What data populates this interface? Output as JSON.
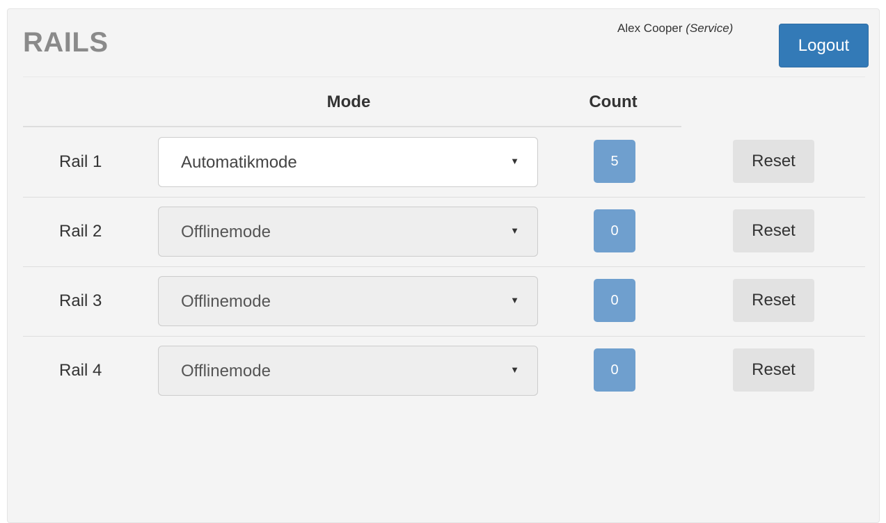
{
  "header": {
    "title": "RAILS",
    "user_name": "Alex Cooper",
    "user_role": "(Service)",
    "logout_label": "Logout"
  },
  "table": {
    "columns": {
      "mode": "Mode",
      "count": "Count"
    },
    "rows": [
      {
        "label": "Rail 1",
        "mode": "Automatikmode",
        "count": "5",
        "reset_label": "Reset",
        "enabled": true
      },
      {
        "label": "Rail 2",
        "mode": "Offlinemode",
        "count": "0",
        "reset_label": "Reset",
        "enabled": false
      },
      {
        "label": "Rail 3",
        "mode": "Offlinemode",
        "count": "0",
        "reset_label": "Reset",
        "enabled": false
      },
      {
        "label": "Rail 4",
        "mode": "Offlinemode",
        "count": "0",
        "reset_label": "Reset",
        "enabled": false
      }
    ]
  },
  "icons": {
    "select_caret": "chevron-down-icon"
  },
  "colors": {
    "primary": "#337ab7",
    "badge": "#6f9fce",
    "reset": "#e2e2e2",
    "panel": "#f4f4f4"
  }
}
